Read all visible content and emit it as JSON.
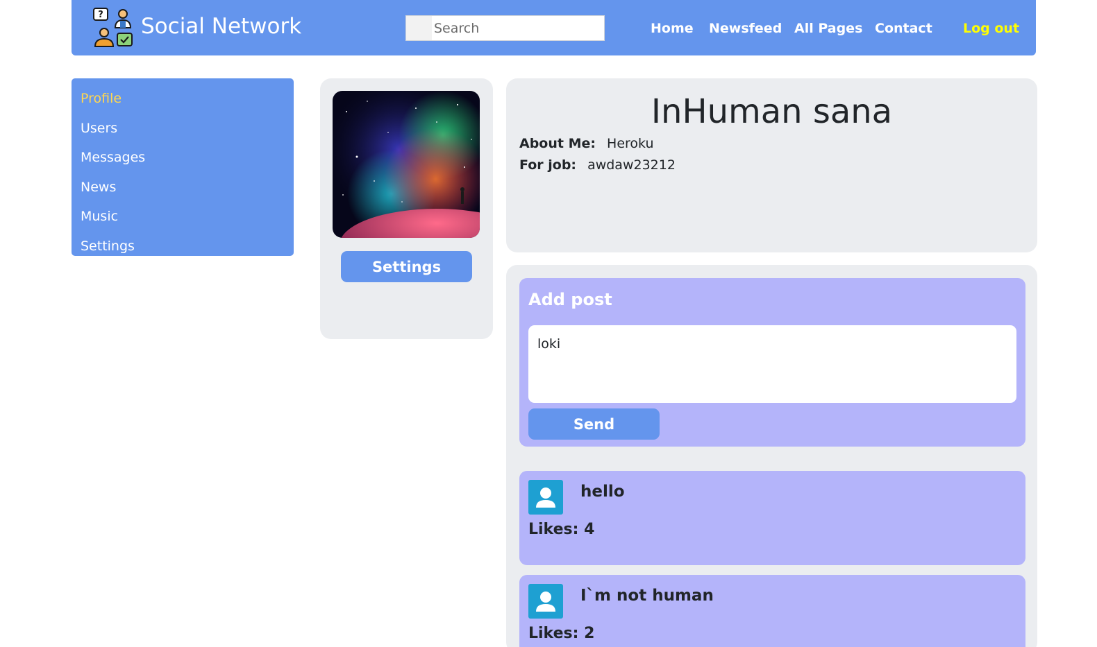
{
  "header": {
    "brand": "Social Network",
    "search_placeholder": "Search",
    "nav": {
      "home": "Home",
      "newsfeed": "Newsfeed",
      "all_pages": "All Pages",
      "contact": "Contact",
      "logout": "Log out"
    }
  },
  "sidebar": {
    "items": [
      {
        "label": "Profile",
        "active": true
      },
      {
        "label": "Users"
      },
      {
        "label": "Messages"
      },
      {
        "label": "News"
      },
      {
        "label": "Music"
      },
      {
        "label": "Settings"
      }
    ]
  },
  "avatar_card": {
    "settings_label": "Settings"
  },
  "profile": {
    "name": "InHuman sana",
    "about_label": "About Me:",
    "about_value": "Heroku",
    "job_label": "For job:",
    "job_value": "awdaw23212"
  },
  "add_post": {
    "title": "Add post",
    "text_value": "loki",
    "send_label": "Send"
  },
  "posts": [
    {
      "text": "hello",
      "likes": "Likes: 4"
    },
    {
      "text": "I`m not human",
      "likes": "Likes: 2"
    }
  ],
  "colors": {
    "accent": "#6495ed",
    "logout": "#ffff00",
    "active_nav": "#ffd750",
    "post_bg": "#b4b4fa",
    "card_bg": "#ebedf0",
    "post_avatar": "#1ea0d2"
  }
}
